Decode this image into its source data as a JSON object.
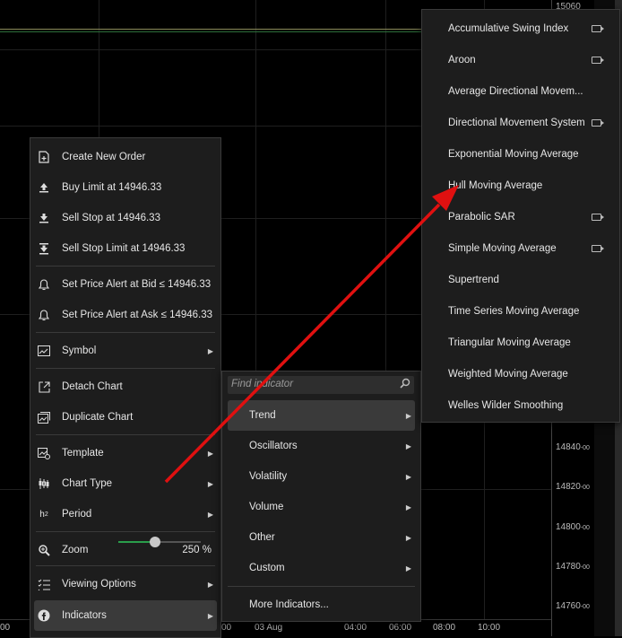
{
  "colors": {
    "menu_bg": "#1d1d1d",
    "accent_green": "#2a9d4b",
    "arrow_red": "#e01010"
  },
  "price_axis": [
    {
      "val": "15060",
      "sub": ""
    },
    {
      "val": "14840",
      "sub": "-00"
    },
    {
      "val": "14820",
      "sub": "-00"
    },
    {
      "val": "14800",
      "sub": "-00"
    },
    {
      "val": "14780",
      "sub": "-00"
    },
    {
      "val": "14760",
      "sub": "-00"
    }
  ],
  "time_axis": [
    "00",
    "00",
    "03 Aug",
    "04:00",
    "06:00",
    "08:00",
    "10:00"
  ],
  "context_menu": {
    "items": [
      {
        "label": "Create New Order",
        "icon": "new-order-icon"
      },
      {
        "label": "Buy Limit at 14946.33",
        "icon": "buy-limit-icon"
      },
      {
        "label": "Sell Stop at 14946.33",
        "icon": "sell-stop-icon"
      },
      {
        "label": "Sell Stop Limit at 14946.33",
        "icon": "sell-stop-limit-icon"
      },
      {
        "label": "Set Price Alert at Bid ≤ 14946.33",
        "icon": "bell-icon"
      },
      {
        "label": "Set Price Alert at Ask ≤ 14946.33",
        "icon": "bell-icon"
      },
      {
        "label": "Symbol",
        "icon": "symbol-icon"
      },
      {
        "label": "Detach Chart",
        "icon": "detach-icon"
      },
      {
        "label": "Duplicate Chart",
        "icon": "duplicate-icon"
      },
      {
        "label": "Template",
        "icon": "template-icon"
      },
      {
        "label": "Chart Type",
        "icon": "candles-icon"
      },
      {
        "label": "Period",
        "icon": "period-icon"
      },
      {
        "label": "Zoom",
        "icon": "zoom-icon",
        "value": "250 %",
        "zoom_level": 0.45
      },
      {
        "label": "Viewing Options",
        "icon": "viewing-options-icon"
      },
      {
        "label": "Indicators",
        "icon": "indicators-icon"
      }
    ]
  },
  "indicator_menu": {
    "search_placeholder": "Find indicator",
    "categories": [
      "Trend",
      "Oscillators",
      "Volatility",
      "Volume",
      "Other",
      "Custom"
    ],
    "more": "More Indicators..."
  },
  "trend_menu": {
    "items": [
      {
        "label": "Accumulative Swing Index",
        "video": true
      },
      {
        "label": "Aroon",
        "video": true
      },
      {
        "label": "Average Directional Movem...",
        "video": false
      },
      {
        "label": "Directional Movement System",
        "video": true
      },
      {
        "label": "Exponential Moving Average",
        "video": false
      },
      {
        "label": "Hull Moving Average",
        "video": false
      },
      {
        "label": "Parabolic SAR",
        "video": true
      },
      {
        "label": "Simple Moving Average",
        "video": true
      },
      {
        "label": "Supertrend",
        "video": false
      },
      {
        "label": "Time Series Moving Average",
        "video": false
      },
      {
        "label": "Triangular Moving Average",
        "video": false
      },
      {
        "label": "Weighted Moving Average",
        "video": false
      },
      {
        "label": "Welles Wilder Smoothing",
        "video": false
      }
    ]
  }
}
